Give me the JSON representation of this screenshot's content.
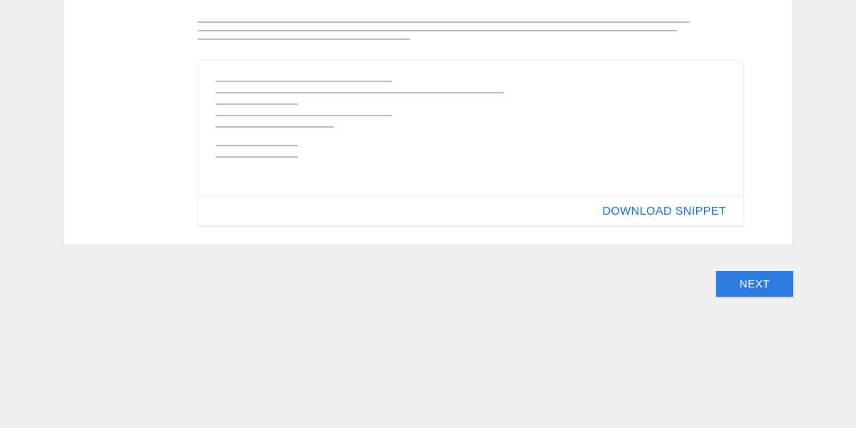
{
  "snippet": {
    "download_label": "DOWNLOAD SNIPPET"
  },
  "nav": {
    "next_label": "NEXT"
  }
}
